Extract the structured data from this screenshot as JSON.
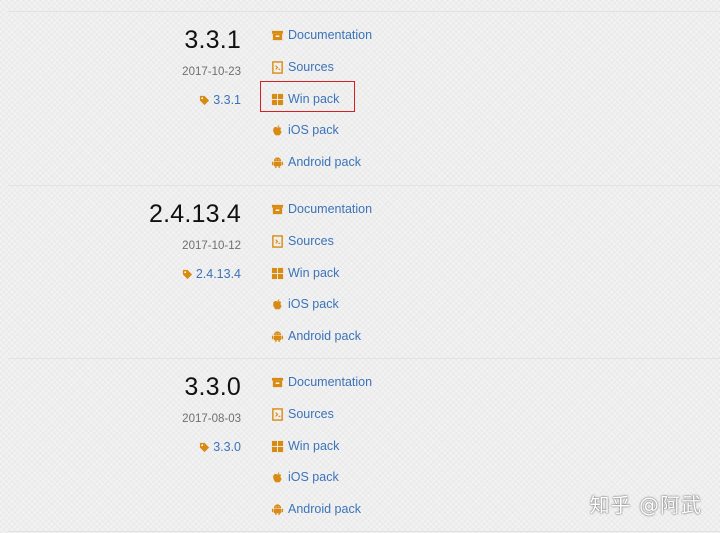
{
  "releases": [
    {
      "version": "3.3.1",
      "date": "2017-10-23",
      "tag": "3.3.1",
      "links": {
        "documentation": "Documentation",
        "sources": "Sources",
        "win_pack": "Win pack",
        "ios_pack": "iOS pack",
        "android_pack": "Android pack"
      }
    },
    {
      "version": "2.4.13.4",
      "date": "2017-10-12",
      "tag": "2.4.13.4",
      "links": {
        "documentation": "Documentation",
        "sources": "Sources",
        "win_pack": "Win pack",
        "ios_pack": "iOS pack",
        "android_pack": "Android pack"
      }
    },
    {
      "version": "3.3.0",
      "date": "2017-08-03",
      "tag": "3.3.0",
      "links": {
        "documentation": "Documentation",
        "sources": "Sources",
        "win_pack": "Win pack",
        "ios_pack": "iOS pack",
        "android_pack": "Android pack"
      }
    }
  ],
  "watermark": "知乎 @阿武",
  "colors": {
    "link": "#3b73b9",
    "icon": "#d98a12",
    "highlight": "#d32020"
  },
  "icons": [
    "archive-icon",
    "source-file-icon",
    "windows-icon",
    "apple-icon",
    "android-icon",
    "tag-icon"
  ]
}
